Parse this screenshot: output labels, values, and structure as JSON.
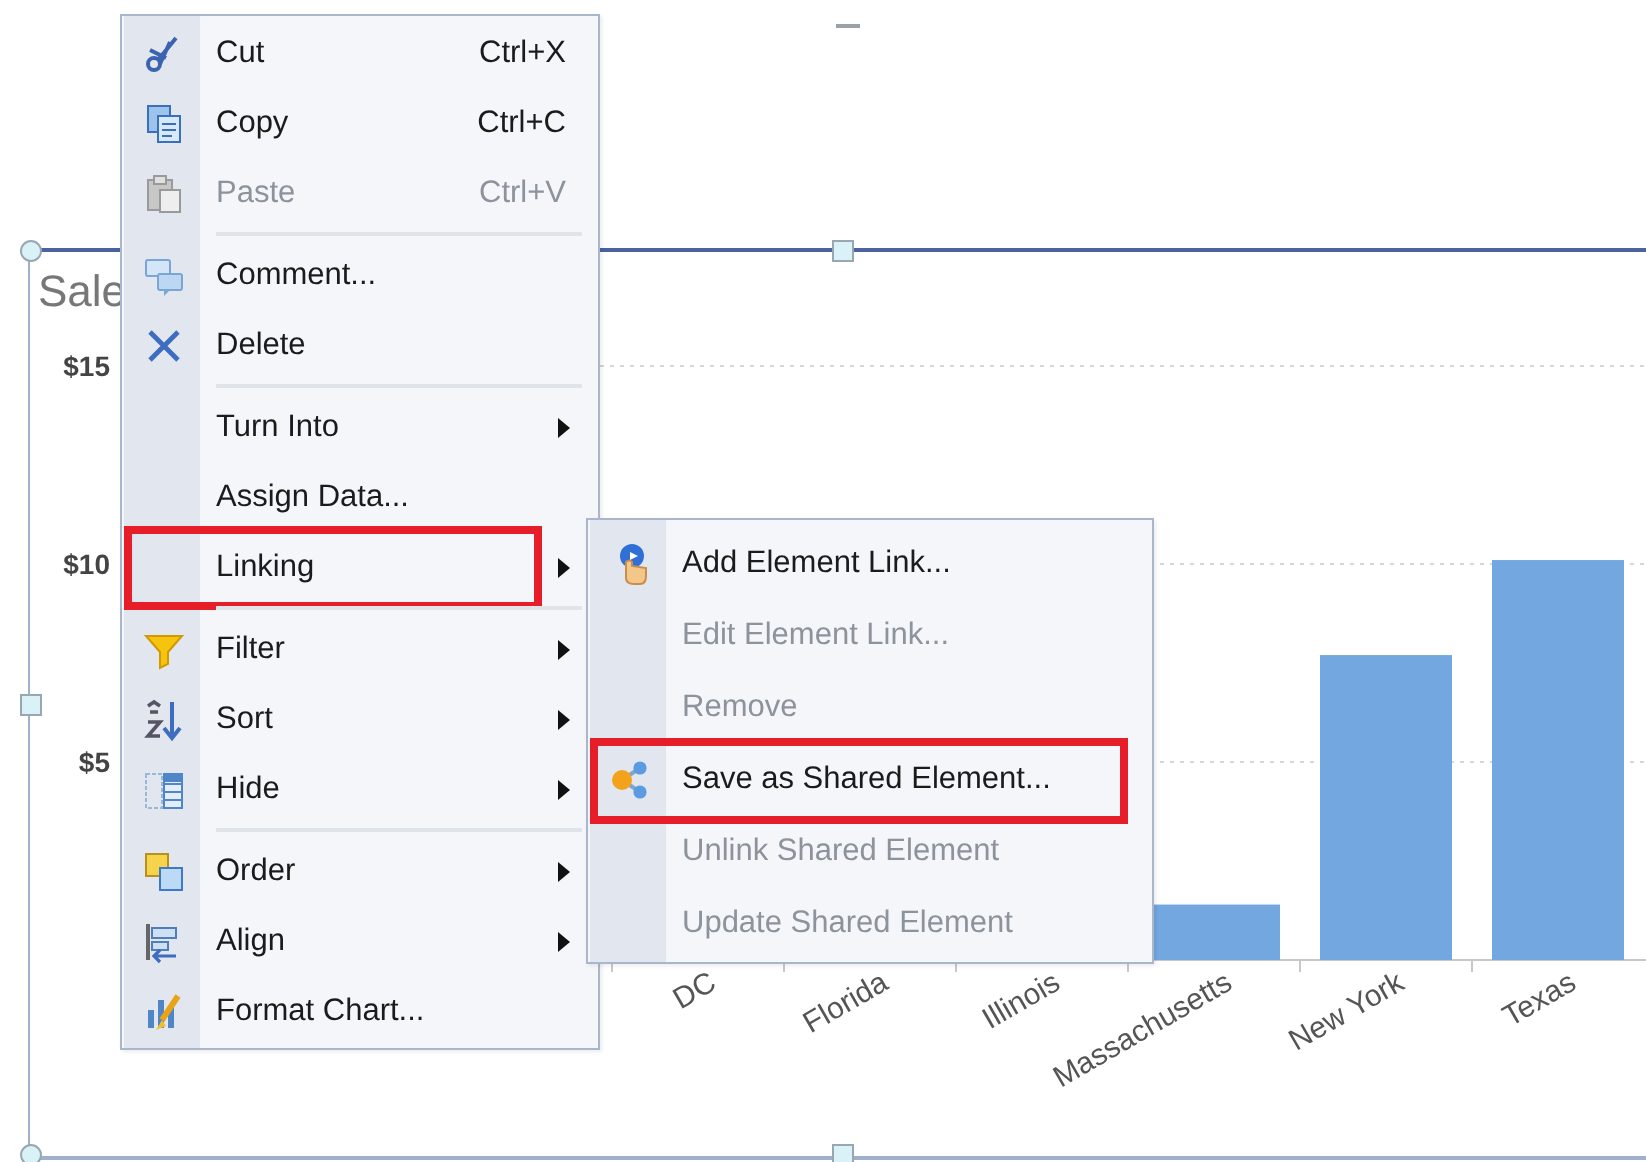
{
  "chart": {
    "title": "Sale",
    "y_axis_labels": [
      "$15",
      "$10",
      "$5"
    ],
    "categories": [
      "DC",
      "Florida",
      "Illinois",
      "Massachusetts",
      "New York",
      "Texas"
    ]
  },
  "context_menu": {
    "items": [
      {
        "kind": "item",
        "label": "Cut",
        "shortcut": "Ctrl+X",
        "disabled": false,
        "submenu": false,
        "highlighted": false
      },
      {
        "kind": "item",
        "label": "Copy",
        "shortcut": "Ctrl+C",
        "disabled": false,
        "submenu": false,
        "highlighted": false
      },
      {
        "kind": "item",
        "label": "Paste",
        "shortcut": "Ctrl+V",
        "disabled": true,
        "submenu": false,
        "highlighted": false
      },
      {
        "kind": "separator"
      },
      {
        "kind": "item",
        "label": "Comment...",
        "disabled": false,
        "submenu": false,
        "highlighted": false
      },
      {
        "kind": "item",
        "label": "Delete",
        "disabled": false,
        "submenu": false,
        "highlighted": false
      },
      {
        "kind": "separator"
      },
      {
        "kind": "item",
        "label": "Turn Into",
        "disabled": false,
        "submenu": true,
        "highlighted": false
      },
      {
        "kind": "item",
        "label": "Assign Data...",
        "disabled": false,
        "submenu": false,
        "highlighted": false
      },
      {
        "kind": "item",
        "label": "Linking",
        "disabled": false,
        "submenu": true,
        "highlighted": true
      },
      {
        "kind": "separator"
      },
      {
        "kind": "item",
        "label": "Filter",
        "disabled": false,
        "submenu": true,
        "highlighted": false
      },
      {
        "kind": "item",
        "label": "Sort",
        "disabled": false,
        "submenu": true,
        "highlighted": false
      },
      {
        "kind": "item",
        "label": "Hide",
        "disabled": false,
        "submenu": true,
        "highlighted": false
      },
      {
        "kind": "separator"
      },
      {
        "kind": "item",
        "label": "Order",
        "disabled": false,
        "submenu": true,
        "highlighted": false
      },
      {
        "kind": "item",
        "label": "Align",
        "disabled": false,
        "submenu": true,
        "highlighted": false
      },
      {
        "kind": "item",
        "label": "Format Chart...",
        "disabled": false,
        "submenu": false,
        "highlighted": false
      }
    ]
  },
  "submenu": {
    "items": [
      {
        "kind": "item",
        "label": "Add Element Link...",
        "disabled": false,
        "highlighted": false
      },
      {
        "kind": "item",
        "label": "Edit Element Link...",
        "disabled": true,
        "highlighted": false
      },
      {
        "kind": "item",
        "label": "Remove",
        "disabled": true,
        "highlighted": false
      },
      {
        "kind": "item",
        "label": "Save as Shared Element...",
        "disabled": false,
        "highlighted": true
      },
      {
        "kind": "item",
        "label": "Unlink Shared Element",
        "disabled": true,
        "highlighted": false
      },
      {
        "kind": "item",
        "label": "Update Shared Element",
        "disabled": true,
        "highlighted": false
      }
    ]
  }
}
